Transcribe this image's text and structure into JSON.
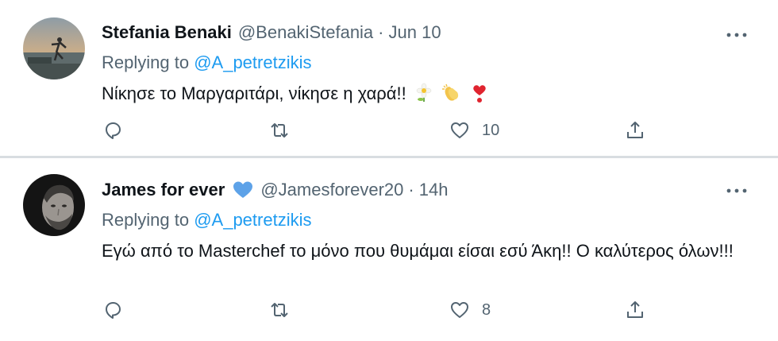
{
  "tweets": [
    {
      "author_name": "Stefania Benaki",
      "handle": "@BenakiStefania",
      "separator": "·",
      "time": "Jun 10",
      "replying_prefix": "Replying to",
      "replying_to": "@A_petretzikis",
      "text": "Νίκησε το Μαργαριτάρι, νίκησε η χαρά!!",
      "emoji": [
        "daisy-emoji",
        "clapping-hands-emoji",
        "heart-exclamation-emoji"
      ],
      "likes": "10"
    },
    {
      "author_name": "James for ever",
      "handle": "@Jamesforever20",
      "separator": "·",
      "time": "14h",
      "replying_prefix": "Replying to",
      "replying_to": "@A_petretzikis",
      "text": "Εγώ από το Masterchef το μόνο που θυμάμαι είσαι εσύ Άκη!! Ο καλύτερος όλων!!!",
      "likes": "8"
    }
  ],
  "colors": {
    "link": "#1d9bf0",
    "muted": "#536471",
    "verified_heart": "#5da2e8"
  },
  "icons": [
    "reply-icon",
    "retweet-icon",
    "like-icon",
    "share-icon",
    "more-icon"
  ]
}
